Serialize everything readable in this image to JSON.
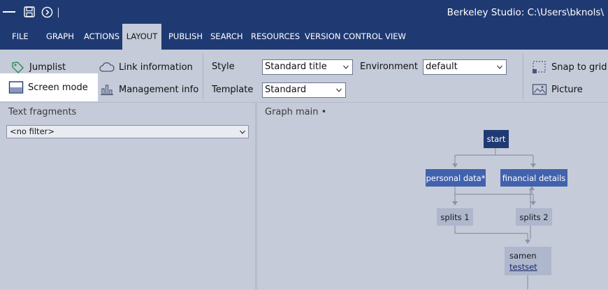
{
  "titlebar": {
    "title": "Berkeley Studio: C:\\Users\\bknols\\"
  },
  "menu": {
    "tabs": [
      {
        "label": "FILE"
      },
      {
        "label": "GRAPH"
      },
      {
        "label": "ACTIONS"
      },
      {
        "label": "LAYOUT"
      },
      {
        "label": "PUBLISH"
      },
      {
        "label": "SEARCH"
      },
      {
        "label": "RESOURCES"
      },
      {
        "label": "VERSION CONTROL"
      },
      {
        "label": "VIEW"
      }
    ],
    "active": "LAYOUT"
  },
  "ribbon": {
    "jumplist": "Jumplist",
    "screen_mode": "Screen mode",
    "link_information": "Link information",
    "management_info": "Management info",
    "style_label": "Style",
    "style_value": "Standard title",
    "template_label": "Template",
    "template_value": "Standard",
    "environment_label": "Environment",
    "environment_value": "default",
    "snap_to_grid": "Snap to grid",
    "picture": "Picture"
  },
  "left_pane": {
    "title": "Text fragments",
    "filter_value": "<no filter>"
  },
  "right_pane": {
    "title": "Graph main •"
  },
  "graph": {
    "nodes": {
      "start": "start",
      "personal_data": "personal data*",
      "financial_details": "financial details",
      "splits_1": "splits 1",
      "splits_2": "splits 2",
      "samen": "samen",
      "samen_link": "testset"
    }
  },
  "colors": {
    "chrome_blue": "#1f3a73",
    "node_dark": "#1f3a73",
    "node_mid": "#4362ad",
    "node_light": "#aeb7cc",
    "background": "#c5cbd8"
  }
}
